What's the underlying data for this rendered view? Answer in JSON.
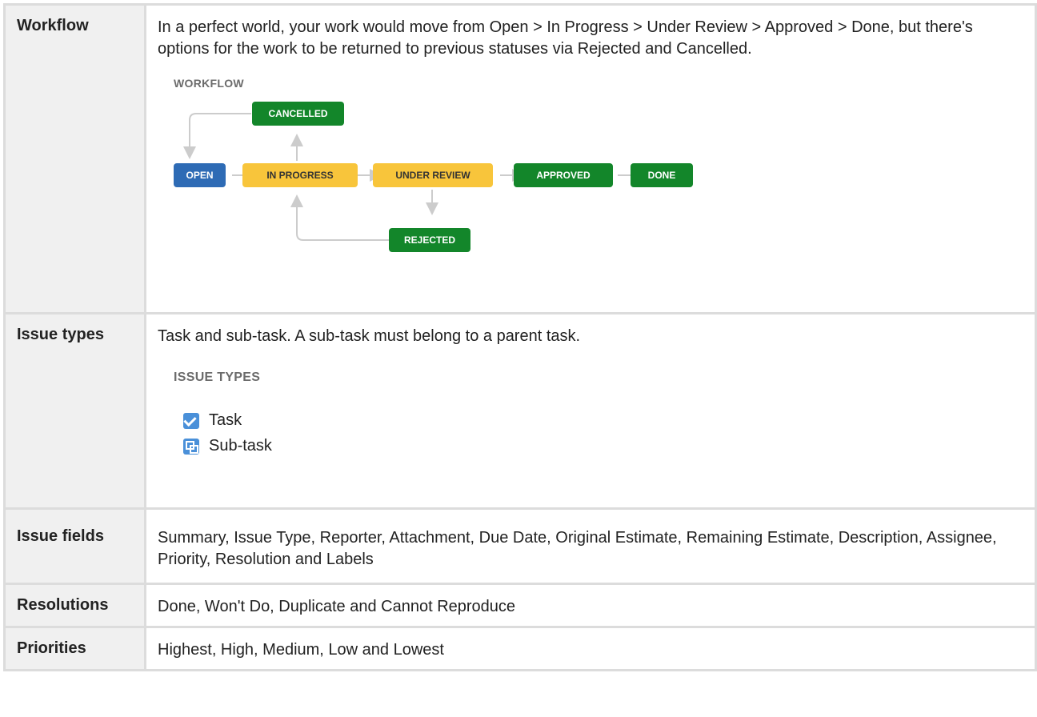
{
  "rows": {
    "workflow": {
      "label": "Workflow",
      "text": "In a perfect world, your work would move from Open > In Progress > Under Review > Approved > Done, but there's options for the work to be returned to previous statuses via Rejected and Cancelled.",
      "diagram": {
        "title": "WORKFLOW",
        "statuses": {
          "open": "OPEN",
          "in_progress": "IN PROGRESS",
          "under_review": "UNDER REVIEW",
          "approved": "APPROVED",
          "done": "DONE",
          "cancelled": "CANCELLED",
          "rejected": "REJECTED"
        },
        "colors": {
          "blue": "#2e6bb5",
          "yellow": "#f8c53b",
          "green": "#13862a",
          "arrow": "#cccccc"
        }
      }
    },
    "issue_types": {
      "label": "Issue types",
      "text": "Task and sub-task. A sub-task must belong to a parent task.",
      "title": "ISSUE TYPES",
      "items": [
        {
          "label": "Task",
          "icon": "checkbox-icon"
        },
        {
          "label": "Sub-task",
          "icon": "subtask-icon"
        }
      ]
    },
    "issue_fields": {
      "label": "Issue fields",
      "text": "Summary, Issue Type, Reporter, Attachment, Due Date, Original Estimate, Remaining Estimate, Description, Assignee, Priority, Resolution and Labels"
    },
    "resolutions": {
      "label": "Resolutions",
      "text": "Done, Won't Do, Duplicate and Cannot Reproduce"
    },
    "priorities": {
      "label": "Priorities",
      "text": "Highest, High, Medium, Low and Lowest"
    }
  }
}
